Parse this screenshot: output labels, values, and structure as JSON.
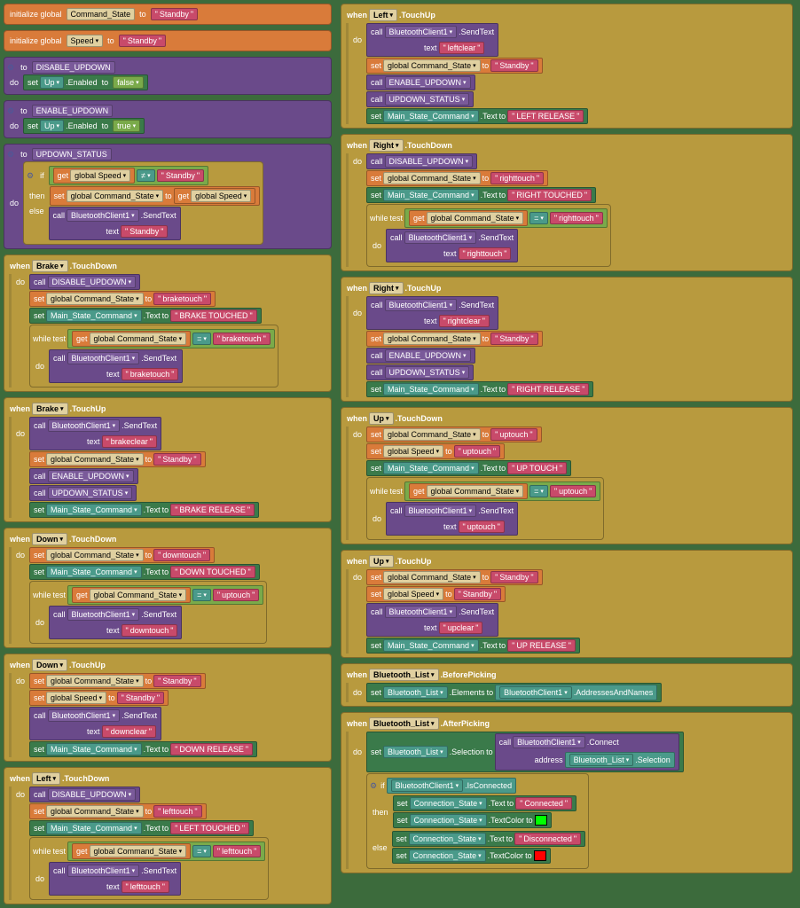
{
  "globals": {
    "init1_label": "initialize global",
    "init1_var": "Command_State",
    "init1_to": "to",
    "init1_val": "Standby",
    "init2_var": "Speed",
    "init2_val": "Standby"
  },
  "procs": {
    "to_lbl": "to",
    "disable": "DISABLE_UPDOWN",
    "enable": "ENABLE_UPDOWN",
    "updown": "UPDOWN_STATUS",
    "do_lbl": "do",
    "set_lbl": "set",
    "up_enabled": "Up",
    "enabled_prop": ".Enabled",
    "false_val": "false",
    "true_val": "true",
    "to_kw": "to"
  },
  "updown_status": {
    "if_lbl": "if",
    "then_lbl": "then",
    "else_lbl": "else",
    "get_lbl": "get",
    "gspeed": "global Speed",
    "neq": "≠",
    "standby": "Standby",
    "set_gcs": "global Command_State",
    "call_lbl": "call",
    "bt": "BluetoothClient1",
    "sendtext": ".SendText",
    "text_lbl": "text"
  },
  "events": {
    "when_lbl": "when",
    "do_lbl": "do",
    "brake": "Brake",
    "down": "Down",
    "left": "Left",
    "right": "Right",
    "up": "Up",
    "touchdown": ".TouchDown",
    "touchup": ".TouchUp",
    "call_lbl": "call",
    "disable_updown": "DISABLE_UPDOWN",
    "enable_updown": "ENABLE_UPDOWN",
    "updown_status": "UPDOWN_STATUS",
    "set_lbl": "set",
    "gcs": "global Command_State",
    "gspeed": "global Speed",
    "to_lbl": "to",
    "msc": "Main_State_Command",
    "text_prop": ".Text",
    "while_lbl": "while",
    "test_lbl": "test",
    "get_lbl": "get",
    "eq": "=",
    "bt": "BluetoothClient1",
    "sendtext": ".SendText",
    "text_arg": "text",
    "braketouch": "braketouch",
    "brake_touched": "BRAKE TOUCHED",
    "brakeclear": "brakeclear",
    "standby": "Standby",
    "brake_release": "BRAKE RELEASE",
    "downtouch": "downtouch",
    "down_touched": "DOWN TOUCHED",
    "uptouch_cmp": "uptouch",
    "downclear": "downclear",
    "down_release": "DOWN RELEASE",
    "lefttouch": "lefttouch",
    "left_touched": "LEFT TOUCHED",
    "leftclear": "leftclear",
    "left_release": "LEFT RELEASE",
    "righttouch": "righttouch",
    "right_touched": "RIGHT TOUCHED",
    "rightclear": "rightclear",
    "right_release": "RIGHT RELEASE",
    "uptouch": "uptouch",
    "up_touch": "UP TOUCH",
    "upclear": "upclear",
    "up_release": "UP RELEASE"
  },
  "btlist": {
    "comp": "Bluetooth_List",
    "before": ".BeforePicking",
    "after": ".AfterPicking",
    "elements": ".Elements",
    "btc": "BluetoothClient1",
    "addrnames": ".AddressesAndNames",
    "selection": ".Selection",
    "connect": ".Connect",
    "address_lbl": "address",
    "isconnected": ".IsConnected",
    "conn_state": "Connection_State",
    "textcolor": ".TextColor",
    "connected": "Connected",
    "disconnected": "Disconnected",
    "if_lbl": "if",
    "then_lbl": "then",
    "else_lbl": "else"
  }
}
